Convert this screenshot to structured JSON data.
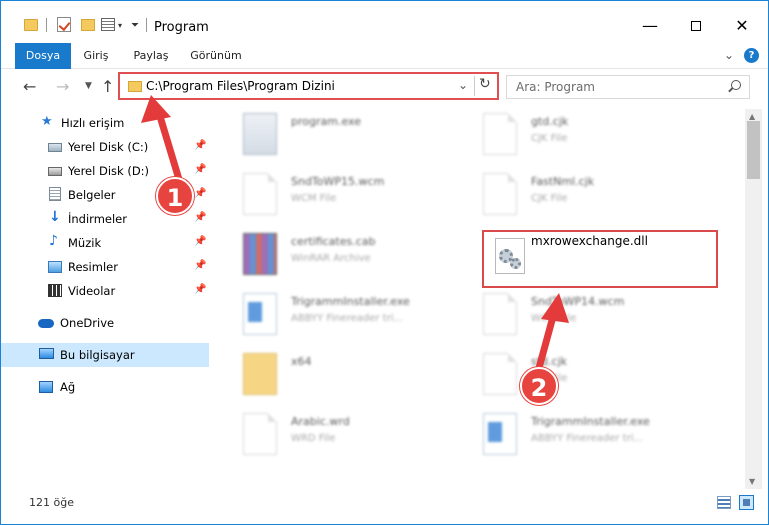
{
  "window": {
    "title": "Program"
  },
  "ribbon": {
    "tabs": [
      "Dosya",
      "Giriş",
      "Paylaş",
      "Görünüm"
    ],
    "help": "?"
  },
  "address": {
    "path": "C:\\Program Files\\Program Dizini",
    "search_placeholder": "Ara: Program"
  },
  "sidebar": {
    "items": [
      {
        "label": "Hızlı erişim"
      },
      {
        "label": "Yerel Disk (C:)"
      },
      {
        "label": "Yerel Disk (D:)"
      },
      {
        "label": "Belgeler"
      },
      {
        "label": "İndirmeler"
      },
      {
        "label": "Müzik"
      },
      {
        "label": "Resimler"
      },
      {
        "label": "Videolar"
      },
      {
        "label": "OneDrive"
      },
      {
        "label": "Bu bilgisayar"
      },
      {
        "label": "Ağ"
      }
    ]
  },
  "files": [
    {
      "name": "program.exe",
      "type": ""
    },
    {
      "name": "gtd.cjk",
      "type": "CJK File"
    },
    {
      "name": "SndToWP15.wcm",
      "type": "WCM File"
    },
    {
      "name": "FastNml.cjk",
      "type": "CJK File"
    },
    {
      "name": "certificates.cab",
      "type": "WinRAR Archive"
    },
    {
      "name": "mxrowexchange.dll",
      "type": ""
    },
    {
      "name": "TrigrammInstaller.exe",
      "type": "ABBYY Finereader tri..."
    },
    {
      "name": "SndToWP14.wcm",
      "type": "WCM File"
    },
    {
      "name": "x64",
      "type": ""
    },
    {
      "name": "std.cjk",
      "type": "CJK File"
    },
    {
      "name": "Arabic.wrd",
      "type": "WRD File"
    },
    {
      "name": "TrigrammInstaller.exe",
      "type": "ABBYY Finereader tri..."
    }
  ],
  "status": {
    "count": "121 öğe"
  },
  "annotations": {
    "step1": "1",
    "step2": "2"
  },
  "colors": {
    "accent": "#1979ca",
    "highlight": "#d94a4a",
    "selected": "#cce8ff"
  }
}
